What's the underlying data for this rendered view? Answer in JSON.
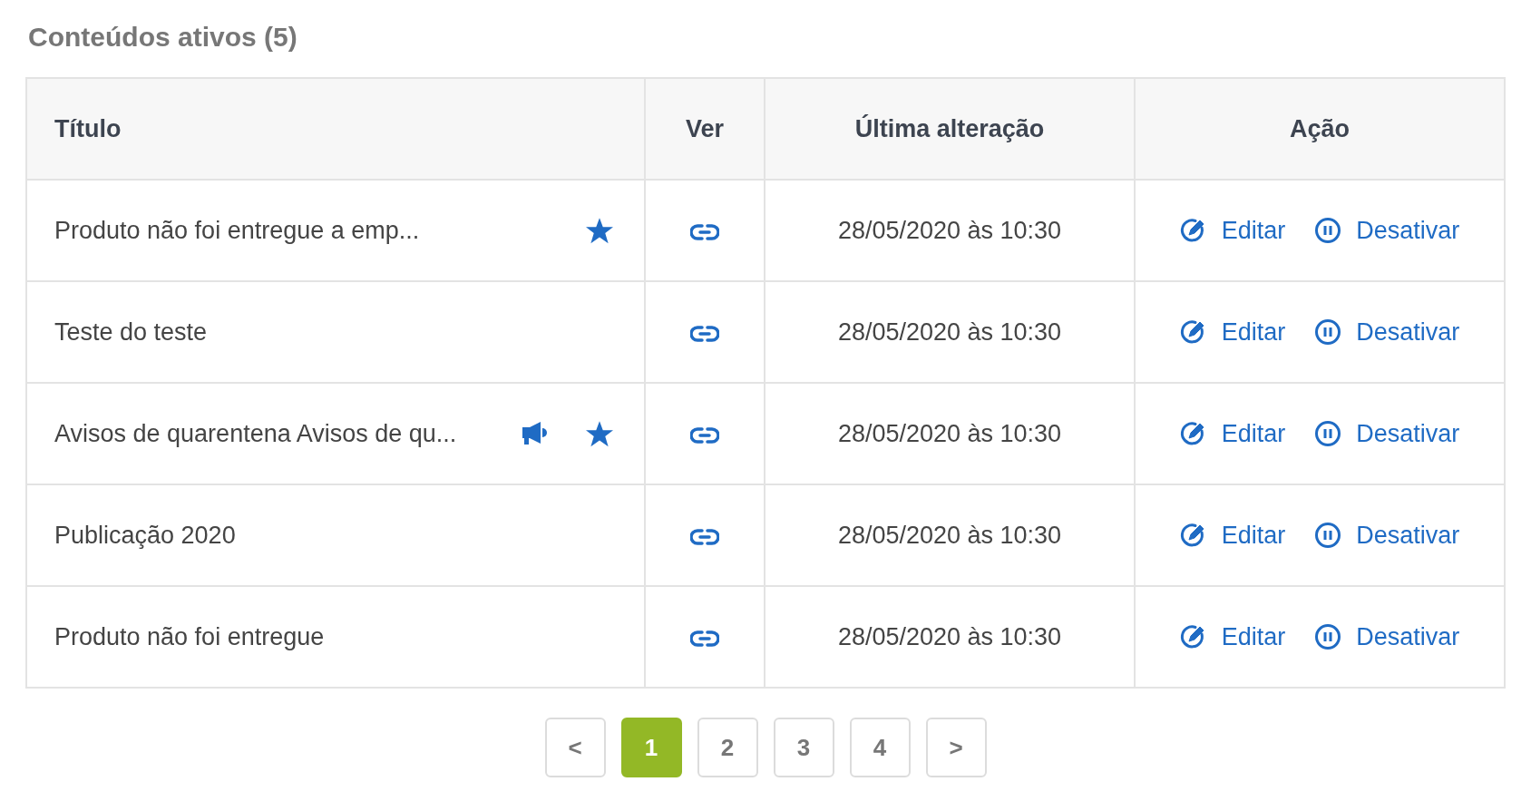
{
  "heading": "Conteúdos ativos (5)",
  "table": {
    "columns": [
      "Título",
      "Ver",
      "Última alteração",
      "Ação"
    ],
    "rows": [
      {
        "title": "Produto não foi entregue a emp...",
        "announcement": false,
        "starred": true,
        "date": "28/05/2020 às 10:30",
        "edit": "Editar",
        "deactivate": "Desativar"
      },
      {
        "title": "Teste do teste",
        "announcement": false,
        "starred": false,
        "date": "28/05/2020 às 10:30",
        "edit": "Editar",
        "deactivate": "Desativar"
      },
      {
        "title": "Avisos de quarentena Avisos de qu...",
        "announcement": true,
        "starred": true,
        "date": "28/05/2020 às 10:30",
        "edit": "Editar",
        "deactivate": "Desativar"
      },
      {
        "title": "Publicação 2020",
        "announcement": false,
        "starred": false,
        "date": "28/05/2020 às 10:30",
        "edit": "Editar",
        "deactivate": "Desativar"
      },
      {
        "title": "Produto não foi entregue",
        "announcement": false,
        "starred": false,
        "date": "28/05/2020 às 10:30",
        "edit": "Editar",
        "deactivate": "Desativar"
      }
    ]
  },
  "pagination": {
    "previous": "<",
    "next": ">",
    "pages": [
      {
        "label": "1",
        "selected": true
      },
      {
        "label": "2",
        "selected": false
      },
      {
        "label": "3",
        "selected": false
      },
      {
        "label": "4",
        "selected": false
      }
    ]
  }
}
